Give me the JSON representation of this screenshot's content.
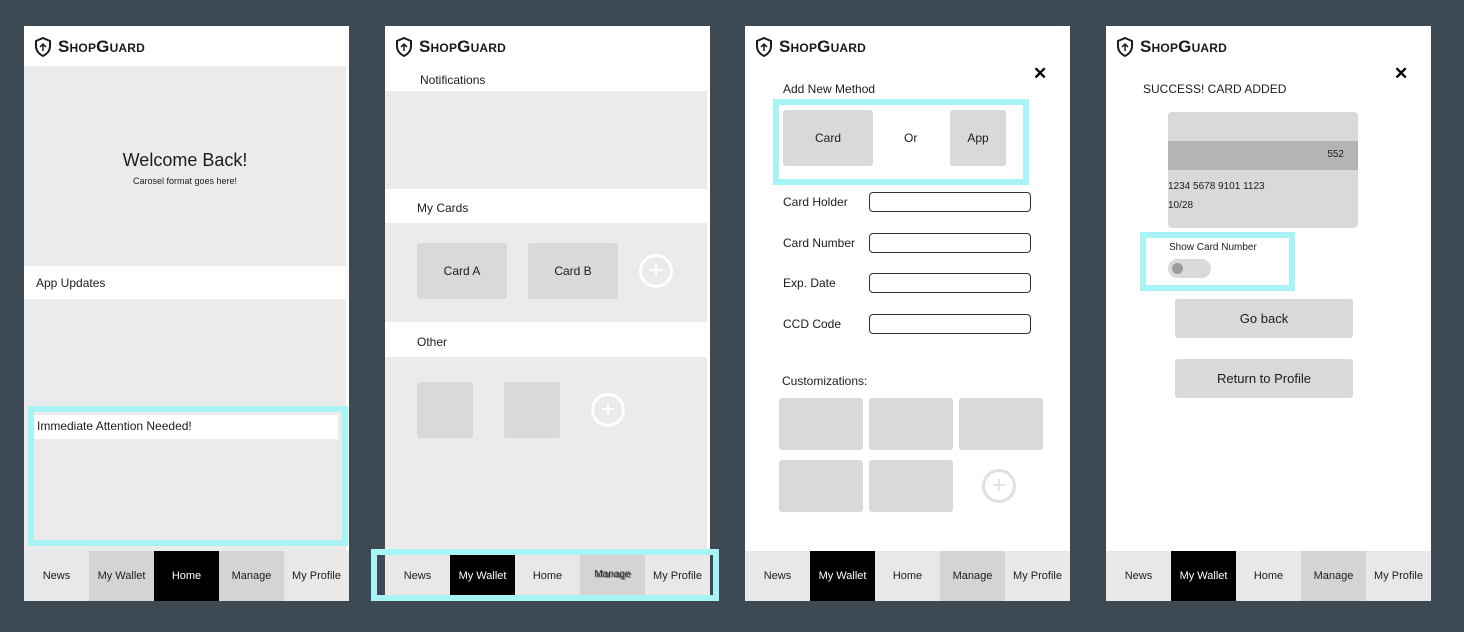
{
  "brand": "ShopGuard",
  "screens": {
    "home": {
      "welcome_title": "Welcome Back!",
      "welcome_sub": "Carosel format goes here!",
      "app_updates": "App Updates",
      "attention": "Immediate Attention Needed!"
    },
    "wallet": {
      "notifications": "Notifications",
      "my_cards": "My Cards",
      "card_a": "Card A",
      "card_b": "Card B",
      "other": "Other"
    },
    "add_method": {
      "close": "✕",
      "title": "Add New Method",
      "card_option": "Card",
      "or": "Or",
      "app_option": "App",
      "card_holder": "Card Holder",
      "card_number": "Card Number",
      "exp_date": "Exp. Date",
      "ccd_code": "CCD Code",
      "customizations": "Customizations:"
    },
    "success": {
      "close": "✕",
      "title": "SUCCESS! CARD ADDED",
      "card_last": "552",
      "card_number": "1234 5678 9101 1123",
      "card_exp": "10/28",
      "show_number": "Show Card Number",
      "go_back": "Go back",
      "return_profile": "Return to Profile"
    }
  },
  "nav": {
    "news": "News",
    "wallet": "My Wallet",
    "home": "Home",
    "manage": "Manage",
    "profile": "My Profile",
    "manage_overlap": "Manage"
  },
  "colors": {
    "background": "#3d4a54",
    "highlight": "#a7f3f5",
    "active_tab": "#000000"
  }
}
